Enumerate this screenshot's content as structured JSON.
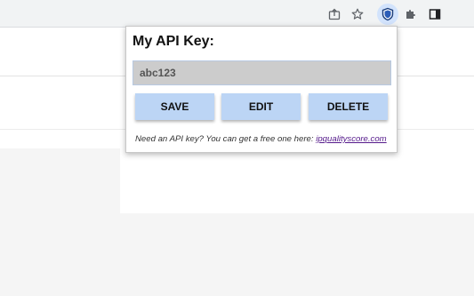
{
  "browser": {
    "toolbar_icons": [
      "share-icon",
      "bookmark-star-icon",
      "shield-extension-icon",
      "puzzle-extensions-icon",
      "side-panel-icon"
    ]
  },
  "popup": {
    "title": "My API Key:",
    "api_key_value": "abc123",
    "buttons": {
      "save": "SAVE",
      "edit": "EDIT",
      "delete": "DELETE"
    },
    "helper_text": "Need an API key? You can get a free one here: ",
    "helper_link": "ipqualityscore.com"
  },
  "colors": {
    "button_bg": "#bcd5f5",
    "input_bg": "#cccccc",
    "link": "#551a8b",
    "active_extension_bg": "#d2e3fc"
  }
}
